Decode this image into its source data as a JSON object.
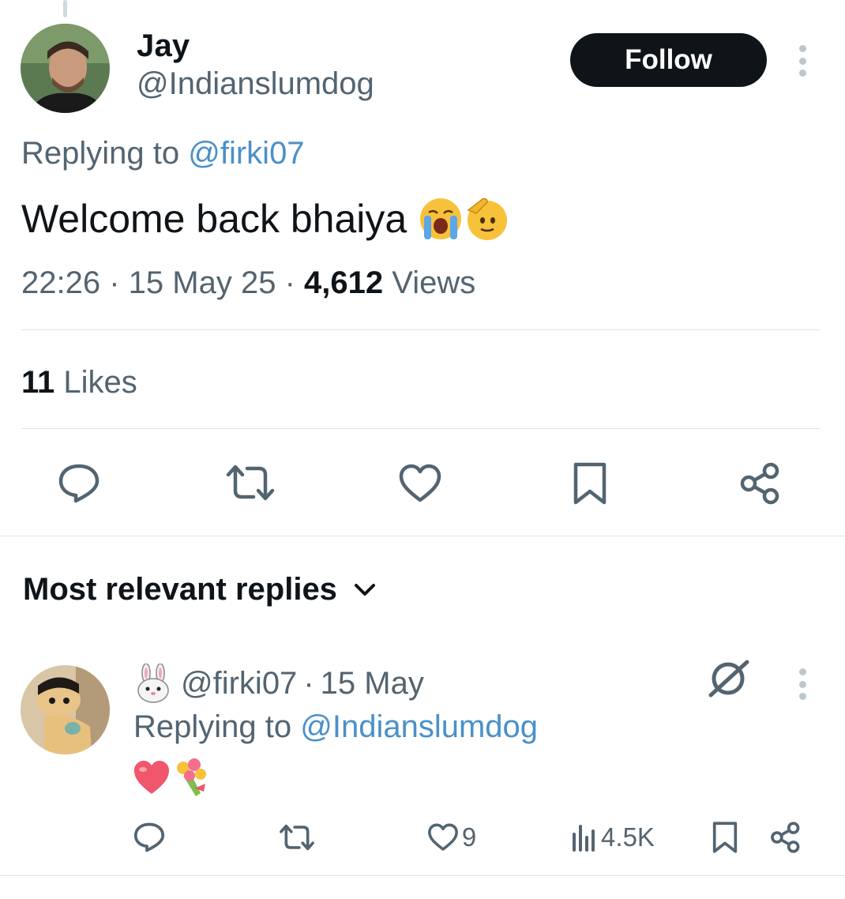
{
  "tweet": {
    "display_name": "Jay",
    "handle": "@Indianslumdog",
    "follow_label": "Follow",
    "replying_prefix": "Replying to",
    "replying_handle": "@firki07",
    "text": "Welcome back bhaiya",
    "emojis": [
      "loudly-crying-face",
      "saluting-face"
    ],
    "time": "22:26",
    "date": "15 May 25",
    "views_count": "4,612",
    "views_label": "Views",
    "likes_count": "11",
    "likes_label": "Likes",
    "actions": [
      "reply-icon",
      "retweet-icon",
      "like-icon",
      "bookmark-icon",
      "share-icon"
    ]
  },
  "replies_section": {
    "title": "Most relevant replies",
    "dropdown_icon": "chevron-down-icon"
  },
  "reply": {
    "name_emoji": "rabbit-face",
    "handle": "@firki07",
    "separator": "·",
    "date": "15 May",
    "replying_prefix": "Replying to",
    "replying_handle": "@Indianslumdog",
    "body_emojis": [
      "red-heart",
      "bouquet"
    ],
    "like_count": "9",
    "views_count": "4.5K",
    "actions": [
      "reply-icon",
      "retweet-icon",
      "like-icon",
      "views-icon",
      "bookmark-icon",
      "share-icon"
    ]
  },
  "colors": {
    "text": "#0f1419",
    "secondary": "#536471",
    "link": "#4a90c9",
    "divider": "#dfe4e8",
    "button_bg": "#0f1419"
  }
}
